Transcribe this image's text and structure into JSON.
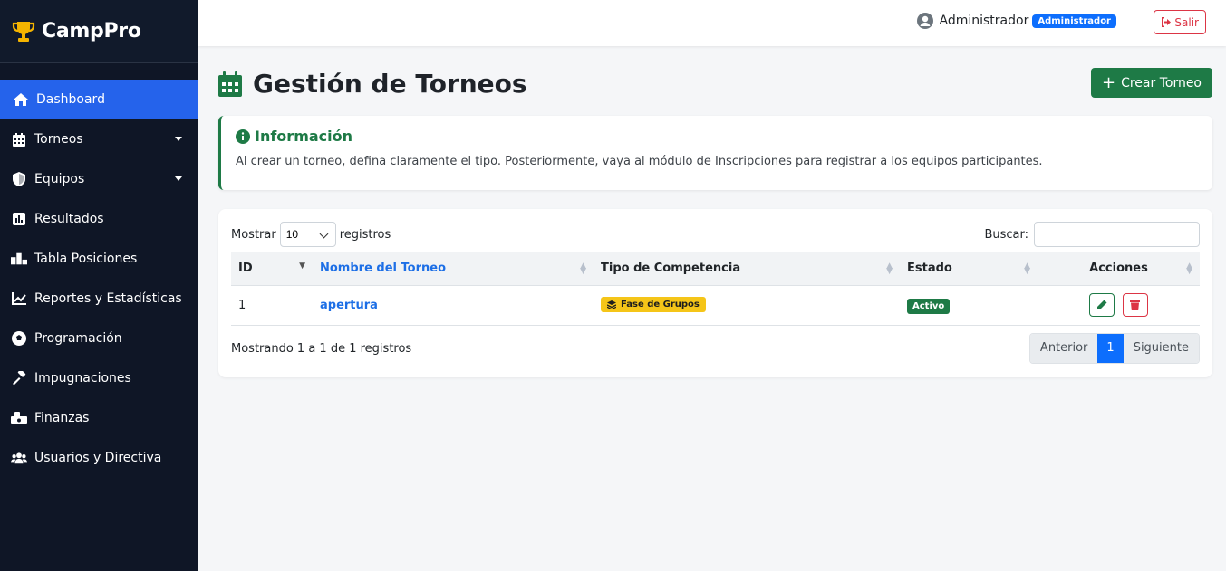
{
  "brand": {
    "name": "CampPro"
  },
  "sidebar": {
    "items": [
      {
        "label": "Dashboard",
        "icon": "home-icon",
        "active": true
      },
      {
        "label": "Torneos",
        "icon": "calendar-icon",
        "dropdown": true
      },
      {
        "label": "Equipos",
        "icon": "shield-icon",
        "dropdown": true
      },
      {
        "label": "Resultados",
        "icon": "chart-icon"
      },
      {
        "label": "Tabla Posiciones",
        "icon": "podium-icon"
      },
      {
        "label": "Reportes y Estadísticas",
        "icon": "line-chart-icon"
      },
      {
        "label": "Programación",
        "icon": "football-icon"
      },
      {
        "label": "Impugnaciones",
        "icon": "gavel-icon"
      },
      {
        "label": "Finanzas",
        "icon": "money-icon"
      },
      {
        "label": "Usuarios y Directiva",
        "icon": "users-icon"
      }
    ]
  },
  "topbar": {
    "username": "Administrador",
    "role_badge": "Administrador",
    "logout_label": "Salir"
  },
  "page": {
    "title": "Gestión de Torneos",
    "create_label": "Crear Torneo"
  },
  "info": {
    "title": "Información",
    "text": "Al crear un torneo, defina claramente el tipo. Posteriormente, vaya al módulo de Inscripciones para registrar a los equipos participantes."
  },
  "table": {
    "show_label": "Mostrar",
    "records_label": "registros",
    "page_length": "10",
    "search_label": "Buscar:",
    "search_value": "",
    "columns": [
      "ID",
      "Nombre del Torneo",
      "Tipo de Competencia",
      "Estado",
      "Acciones"
    ],
    "rows": [
      {
        "id": "1",
        "name": "apertura",
        "tipo": "Fase de Grupos",
        "estado": "Activo"
      }
    ],
    "summary": "Mostrando 1 a 1 de 1 registros",
    "pager": {
      "prev": "Anterior",
      "current": "1",
      "next": "Siguiente"
    }
  },
  "colors": {
    "sidebar_bg": "#0f1626",
    "active": "#2563eb",
    "primary_green": "#1e7a46",
    "link_blue": "#1d6fe6",
    "danger": "#dc3545",
    "warning": "#f5c518"
  }
}
